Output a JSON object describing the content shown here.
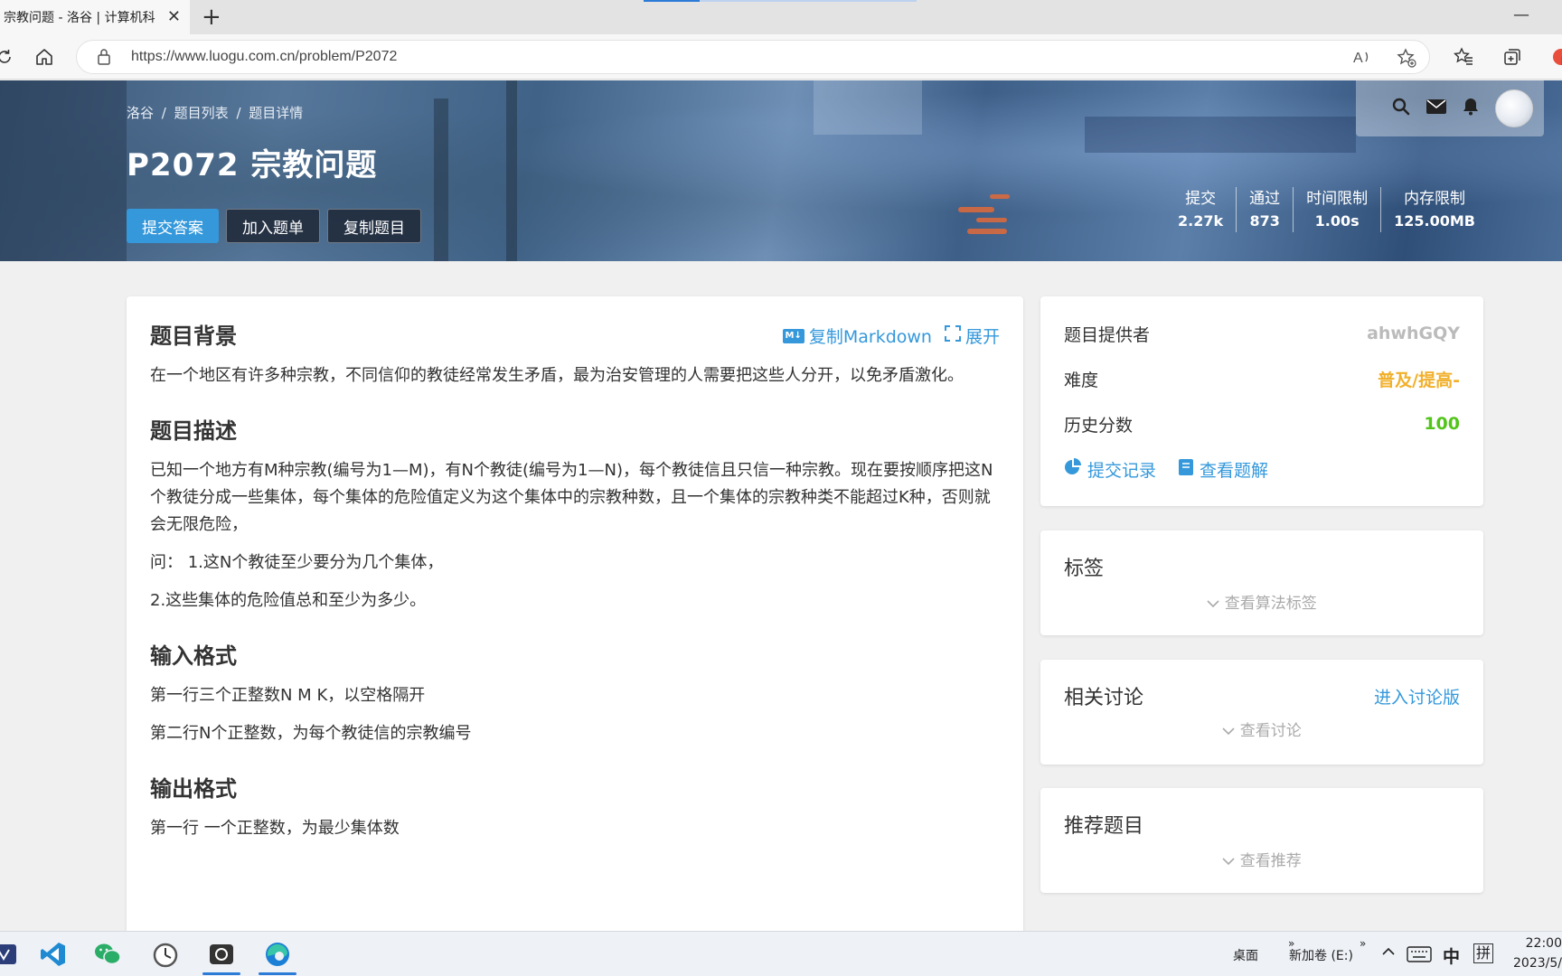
{
  "browser": {
    "tab_title": "宗教问题 - 洛谷 | 计算机科",
    "tab_close": "✕",
    "new_tab": "+",
    "minimize": "—",
    "url": "https://www.luogu.com.cn/problem/P2072"
  },
  "banner": {
    "breadcrumb": [
      "洛谷",
      "/",
      "题目列表",
      "/",
      "题目详情"
    ],
    "title": "P2072 宗教问题",
    "buttons": {
      "submit": "提交答案",
      "add_list": "加入题单",
      "copy": "复制题目"
    },
    "stats": [
      {
        "label": "提交",
        "value": "2.27k"
      },
      {
        "label": "通过",
        "value": "873"
      },
      {
        "label": "时间限制",
        "value": "1.00s"
      },
      {
        "label": "内存限制",
        "value": "125.00MB"
      }
    ]
  },
  "problem": {
    "toolbar": {
      "copy_md": "复制Markdown",
      "expand": "展开",
      "md_icon": "M↓"
    },
    "background_h": "题目背景",
    "background": "在一个地区有许多种宗教，不同信仰的教徒经常发生矛盾，最为治安管理的人需要把这些人分开，以免矛盾激化。",
    "description_h": "题目描述",
    "description": [
      "已知一个地方有M种宗教(编号为1—M)，有N个教徒(编号为1—N)，每个教徒信且只信一种宗教。现在要按顺序把这N个教徒分成一些集体，每个集体的危险值定义为这个集体中的宗教种数，且一个集体的宗教种类不能超过K种，否则就会无限危险，",
      "问：  1.这N个教徒至少要分为几个集体，",
      "2.这些集体的危险值总和至少为多少。"
    ],
    "input_h": "输入格式",
    "input": [
      "第一行三个正整数N M K，以空格隔开",
      "第二行N个正整数，为每个教徒信的宗教编号"
    ],
    "output_h": "输出格式",
    "output": [
      "第一行 一个正整数，为最少集体数"
    ]
  },
  "info": {
    "provider_label": "题目提供者",
    "provider": "ahwhGQY",
    "difficulty_label": "难度",
    "difficulty": "普及/提高-",
    "score_label": "历史分数",
    "score": "100",
    "records": "提交记录",
    "solutions": "查看题解"
  },
  "tags": {
    "title": "标签",
    "expander": "查看算法标签"
  },
  "discuss": {
    "title": "相关讨论",
    "link": "进入讨论版",
    "expander": "查看讨论"
  },
  "recommend": {
    "title": "推荐题目",
    "expander": "查看推荐"
  },
  "taskbar": {
    "desktop": "桌面",
    "drive": "新加卷 (E:)",
    "ime1": "中",
    "ime2": "拼",
    "time": "22:00",
    "date": "2023/5/"
  },
  "colors": {
    "accent": "#3498db",
    "difficulty": "#f1b02b",
    "score": "#52c41a"
  }
}
